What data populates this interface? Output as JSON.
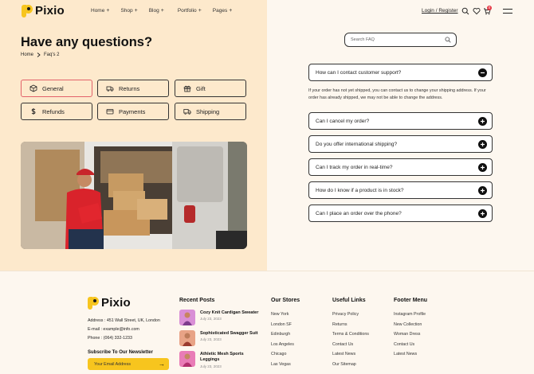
{
  "brand": {
    "name": "Pixio"
  },
  "nav": {
    "items": [
      {
        "label": "Home"
      },
      {
        "label": "Shop"
      },
      {
        "label": "Blog"
      },
      {
        "label": "Portfolio"
      },
      {
        "label": "Pages"
      }
    ],
    "plus": "+",
    "login": "Login / Register",
    "cart_count": "0"
  },
  "page": {
    "title": "Have any questions?",
    "breadcrumb": {
      "home": "Home",
      "current": "Faq's 2"
    }
  },
  "categories": [
    {
      "label": "General",
      "icon": "box-icon",
      "active": true
    },
    {
      "label": "Returns",
      "icon": "truck-return-icon",
      "active": false
    },
    {
      "label": "Gift",
      "icon": "gift-icon",
      "active": false
    },
    {
      "label": "Refunds",
      "icon": "dollar-icon",
      "active": false
    },
    {
      "label": "Payments",
      "icon": "card-icon",
      "active": false
    },
    {
      "label": "Shipping",
      "icon": "truck-icon",
      "active": false
    }
  ],
  "search": {
    "placeholder": "Search FAQ"
  },
  "faq": {
    "items": [
      {
        "question": "How can I contact customer support?",
        "open": true
      },
      {
        "question": "Can I cancel my order?",
        "open": false
      },
      {
        "question": "Do you offer international shipping?",
        "open": false
      },
      {
        "question": "Can I track my order in real-time?",
        "open": false
      },
      {
        "question": "How do I know if a product is in stock?",
        "open": false
      },
      {
        "question": "Can I place an order over the phone?",
        "open": false
      }
    ],
    "answer": "If your order has not yet shipped, you can contact us to change your shipping address. If your order has already shipped, we may not be able to change the address."
  },
  "footer": {
    "address": "Address : 451 Wall Street, UK, London",
    "email": "E-mail : example@info.com",
    "phone": "Phone : (064) 332-1233",
    "newsletter_title": "Subscribe To Our Newsletter",
    "email_placeholder": "Your Email Address",
    "arrow": "→",
    "recent_posts": {
      "heading": "Recent Posts",
      "posts": [
        {
          "title": "Cozy Knit Cardigan Sweater",
          "date": "July 23, 2023"
        },
        {
          "title": "Sophisticated Swagger Suit",
          "date": "July 23, 2023"
        },
        {
          "title": "Athletic Mesh Sports Leggings",
          "date": "July 23, 2023"
        }
      ]
    },
    "our_stores": {
      "heading": "Our Stores",
      "links": [
        "New York",
        "London SF",
        "Edinburgh",
        "Los Angeles",
        "Chicago",
        "Las Vegas"
      ]
    },
    "useful_links": {
      "heading": "Useful Links",
      "links": [
        "Privacy Policy",
        "Returns",
        "Terms & Conditions",
        "Contact Us",
        "Latest News",
        "Our Sitemap"
      ]
    },
    "footer_menu": {
      "heading": "Footer Menu",
      "links": [
        "Instagram Profile",
        "New Collection",
        "Woman Dress",
        "Contact Us",
        "Latest News"
      ]
    }
  },
  "colors": {
    "accent": "#f7c51e",
    "left_bg": "#fde9cc",
    "page_bg": "#fdf7ef",
    "active_border": "#e2616a",
    "badge": "#e63946"
  }
}
